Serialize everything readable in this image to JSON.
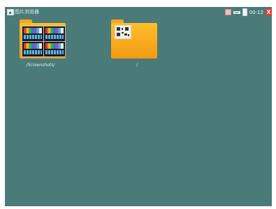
{
  "app": {
    "title": "图片浏览器",
    "time": "00:12",
    "close_label": "X"
  },
  "status_icons": [
    "printer-icon",
    "ethernet-icon",
    "battery-icon"
  ],
  "colors": {
    "background": "#4a7b78",
    "folder": "#f5a621",
    "close_button": "#e23b2f"
  },
  "folders": [
    {
      "label": "/Screenshots/",
      "icon": "folder-thumbnails-icon"
    },
    {
      "label": "/",
      "icon": "folder-qr-icon"
    }
  ]
}
